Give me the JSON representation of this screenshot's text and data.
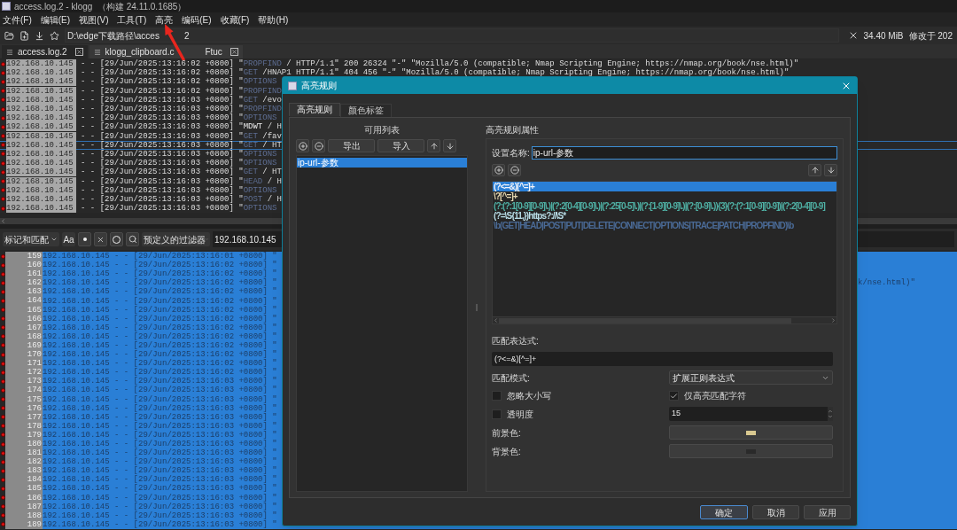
{
  "window": {
    "title": "access.log.2 - klogg",
    "build": "（构建 24.11.0.1685）"
  },
  "menu": [
    "文件(F)",
    "编辑(E)",
    "视图(V)",
    "工具(T)",
    "高亮",
    "编码(E)",
    "收藏(F)",
    "帮助(H)"
  ],
  "toolbar": {
    "path_start": "D:\\edge下载路径\\acces",
    "path_end": "2",
    "size": "34.40 MiB",
    "modified": "修改于 202"
  },
  "tabs": [
    {
      "label": "access.log.2",
      "selected": true
    },
    {
      "label": "klogg_clipboard.c",
      "label_end": "Ftuc",
      "selected": false
    }
  ],
  "top_log": {
    "rows": [
      {
        "ip": "192.168.10.145",
        "prefix": " - - [29/Jun/2025:13:16:02 +0800] \"",
        "method": "PROPFIND",
        "rest": " / HTTP/1.1\" 200 26324 \"-\" \"Mozilla/5.0 (compatible; Nmap Scripting Engine; https://nmap.org/book/nse.html)\"",
        "highlighted": true,
        "selected": false
      },
      {
        "ip": "192.168.10.145",
        "prefix": " - - [29/Jun/2025:13:16:02 +0800] \"",
        "method": "GET",
        "rest": " /HNAP1 HTTP/1.1\" 404 456 \"-\" \"Mozilla/5.0 (compatible; Nmap Scripting Engine; https://nmap.org/book/nse.html)\"",
        "highlighted": true,
        "selected": false
      },
      {
        "ip": "192.168.10.145",
        "prefix": " - - [29/Jun/2025:13:16:02 +0800] \"",
        "method": "OPTIONS",
        "rest": "",
        "highlighted": true,
        "selected": false
      },
      {
        "ip": "192.168.10.145",
        "prefix": " - - [29/Jun/2025:13:16:02 +0800] \"",
        "method": "PROPFIND",
        "rest": "",
        "highlighted": true,
        "selected": false
      },
      {
        "ip": "192.168.10.145",
        "prefix": " - - [29/Jun/2025:13:16:03 +0800] \"",
        "method": "GET",
        "rest": " /evo",
        "highlighted": true,
        "selected": false
      },
      {
        "ip": "192.168.10.145",
        "prefix": " - - [29/Jun/2025:13:16:03 +0800] \"",
        "method": "PROPFIND",
        "rest": "",
        "highlighted": true,
        "selected": false
      },
      {
        "ip": "192.168.10.145",
        "prefix": " - - [29/Jun/2025:13:16:03 +0800] \"",
        "method": "OPTIONS",
        "rest": "",
        "highlighted": true,
        "selected": false
      },
      {
        "ip": "192.168.10.145",
        "prefix": " - - [29/Jun/2025:13:16:03 +0800] \"",
        "method": "MDWT",
        "rest": " / H",
        "highlighted": false,
        "selected": false
      },
      {
        "ip": "192.168.10.145",
        "prefix": " - - [29/Jun/2025:13:16:03 +0800] \"",
        "method": "GET",
        "rest": " /fav",
        "highlighted": true,
        "selected": false
      },
      {
        "ip": "192.168.10.145",
        "prefix": " - - [29/Jun/2025:13:16:03 +0800] \"",
        "method": "GET",
        "rest": " / HT",
        "highlighted": true,
        "selected": true
      },
      {
        "ip": "192.168.10.145",
        "prefix": " - - [29/Jun/2025:13:16:03 +0800] \"",
        "method": "OPTIONS",
        "rest": "",
        "highlighted": true,
        "selected": false
      },
      {
        "ip": "192.168.10.145",
        "prefix": " - - [29/Jun/2025:13:16:03 +0800] \"",
        "method": "OPTIONS",
        "rest": "",
        "highlighted": true,
        "selected": false
      },
      {
        "ip": "192.168.10.145",
        "prefix": " - - [29/Jun/2025:13:16:03 +0800] \"",
        "method": "GET",
        "rest": " / HT",
        "highlighted": true,
        "selected": false
      },
      {
        "ip": "192.168.10.145",
        "prefix": " - - [29/Jun/2025:13:16:03 +0800] \"",
        "method": "HEAD",
        "rest": " / H",
        "highlighted": true,
        "selected": false
      },
      {
        "ip": "192.168.10.145",
        "prefix": " - - [29/Jun/2025:13:16:03 +0800] \"",
        "method": "OPTIONS",
        "rest": "",
        "highlighted": true,
        "selected": false
      },
      {
        "ip": "192.168.10.145",
        "prefix": " - - [29/Jun/2025:13:16:03 +0800] \"",
        "method": "POST",
        "rest": " / H",
        "highlighted": true,
        "selected": false
      },
      {
        "ip": "192.168.10.145",
        "prefix": " - - [29/Jun/2025:13:16:03 +0800] \"",
        "method": "OPTIONS",
        "rest": "",
        "highlighted": true,
        "selected": false
      }
    ]
  },
  "filter_bar": {
    "mode": "标记和匹配",
    "case_button": "Aa",
    "filter": "预定义的过滤器",
    "search": "192.168.10.145"
  },
  "bottom_log": {
    "rows": [
      {
        "line": "159",
        "text": "192.168.10.145 - - [29/Jun/2025:13:16:01 +0800] \""
      },
      {
        "line": "160",
        "text": "192.168.10.145 - - [29/Jun/2025:13:16:02 +0800] \""
      },
      {
        "line": "161",
        "text": "192.168.10.145 - - [29/Jun/2025:13:16:02 +0800] \""
      },
      {
        "line": "162",
        "text": "192.168.10.145 - - [29/Jun/2025:13:16:02 +0800] \"",
        "tail": "k/nse.html)\""
      },
      {
        "line": "163",
        "text": "192.168.10.145 - - [29/Jun/2025:13:16:02 +0800] \""
      },
      {
        "line": "164",
        "text": "192.168.10.145 - - [29/Jun/2025:13:16:02 +0800] \""
      },
      {
        "line": "165",
        "text": "192.168.10.145 - - [29/Jun/2025:13:16:02 +0800] \""
      },
      {
        "line": "166",
        "text": "192.168.10.145 - - [29/Jun/2025:13:16:02 +0800] \""
      },
      {
        "line": "167",
        "text": "192.168.10.145 - - [29/Jun/2025:13:16:02 +0800] \""
      },
      {
        "line": "168",
        "text": "192.168.10.145 - - [29/Jun/2025:13:16:02 +0800] \""
      },
      {
        "line": "169",
        "text": "192.168.10.145 - - [29/Jun/2025:13:16:02 +0800] \""
      },
      {
        "line": "170",
        "text": "192.168.10.145 - - [29/Jun/2025:13:16:02 +0800] \""
      },
      {
        "line": "171",
        "text": "192.168.10.145 - - [29/Jun/2025:13:16:02 +0800] \""
      },
      {
        "line": "172",
        "text": "192.168.10.145 - - [29/Jun/2025:13:16:02 +0800] \""
      },
      {
        "line": "173",
        "text": "192.168.10.145 - - [29/Jun/2025:13:16:03 +0800] \""
      },
      {
        "line": "174",
        "text": "192.168.10.145 - - [29/Jun/2025:13:16:03 +0800] \""
      },
      {
        "line": "175",
        "text": "192.168.10.145 - - [29/Jun/2025:13:16:03 +0800] \""
      },
      {
        "line": "176",
        "text": "192.168.10.145 - - [29/Jun/2025:13:16:03 +0800] \""
      },
      {
        "line": "177",
        "text": "192.168.10.145 - - [29/Jun/2025:13:16:03 +0800] \""
      },
      {
        "line": "178",
        "text": "192.168.10.145 - - [29/Jun/2025:13:16:03 +0800] \""
      },
      {
        "line": "179",
        "text": "192.168.10.145 - - [29/Jun/2025:13:16:03 +0800] \""
      },
      {
        "line": "180",
        "text": "192.168.10.145 - - [29/Jun/2025:13:16:03 +0800] \""
      },
      {
        "line": "181",
        "text": "192.168.10.145 - - [29/Jun/2025:13:16:03 +0800] \""
      },
      {
        "line": "182",
        "text": "192.168.10.145 - - [29/Jun/2025:13:16:03 +0800] \""
      },
      {
        "line": "183",
        "text": "192.168.10.145 - - [29/Jun/2025:13:16:03 +0800] \""
      },
      {
        "line": "184",
        "text": "192.168.10.145 - - [29/Jun/2025:13:16:03 +0800] \""
      },
      {
        "line": "185",
        "text": "192.168.10.145 - - [29/Jun/2025:13:16:03 +0800] \""
      },
      {
        "line": "186",
        "text": "192.168.10.145 - - [29/Jun/2025:13:16:03 +0800] \""
      },
      {
        "line": "187",
        "text": "192.168.10.145 - - [29/Jun/2025:13:16:03 +0800] \""
      },
      {
        "line": "188",
        "text": "192.168.10.145 - - [29/Jun/2025:13:16:03 +0800] \""
      },
      {
        "line": "189",
        "text": "192.168.10.145 - - [29/Jun/2025:13:16:03 +0800] \""
      }
    ]
  },
  "dialog": {
    "title": "高亮规则",
    "tabs": [
      {
        "label": "高亮规则",
        "selected": true
      },
      {
        "label": "颜色标签",
        "selected": false
      }
    ],
    "list_title": "可用列表",
    "export": "导出",
    "import": "导入",
    "rules": [
      {
        "label": "ip-url-参数",
        "selected": true
      }
    ],
    "props_title": "高亮规则属性",
    "name_label": "设置名称:",
    "name_value": "ip-url-参数",
    "patterns": [
      {
        "text": "(?<=&)[^=]+",
        "selected": true
      },
      {
        "text": "\\?[^=]+",
        "color": "#e4d6b0",
        "selected": false
      },
      {
        "text": "(?:(?:1[0-9][0-9]\\.)|(?:2[0-4][0-9]\\.)|(?:25[0-5]\\.)|(?:[1-9][0-9]\\.)|(?:[0-9]\\.)){3}(?:(?:1[0-9][0-9])|(?:2[0-4][0-9]",
        "color": "#4fb0a4",
        "selected": false
      },
      {
        "text": "(?=\\S{11,})https?://\\S*",
        "color": "#b8dce6",
        "selected": false
      },
      {
        "text": "\\b(GET|HEAD|POST|PUT|DELETE|CONNECT|OPTIONS|TRACE|PATCH|PROPFIND)\\b",
        "color": "#4a6a96",
        "selected": false
      }
    ],
    "match_label": "匹配表达式:",
    "match_value": "(?<=&)[^=]+",
    "mode_label": "匹配模式:",
    "mode_value": "扩展正则表达式",
    "ignore_case": {
      "label": "忽略大小写",
      "checked": false
    },
    "highlight_only": {
      "label": "仅高亮匹配字符",
      "checked": true
    },
    "opacity": {
      "label": "透明度",
      "checked": false,
      "value": "15"
    },
    "foreground": {
      "label": "前景色:",
      "color": "#d8c890"
    },
    "background": {
      "label": "背景色:",
      "color": "#2a2a2a"
    },
    "buttons": [
      {
        "label": "确定",
        "default": true
      },
      {
        "label": "取消",
        "default": false
      },
      {
        "label": "应用",
        "default": false
      }
    ]
  }
}
